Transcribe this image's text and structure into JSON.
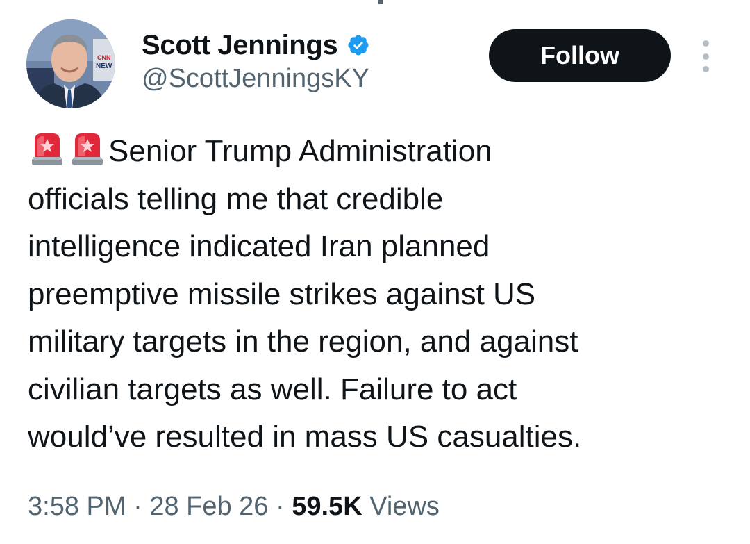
{
  "author": {
    "display_name": "Scott Jennings",
    "handle": "@ScottJenningsKY",
    "verified": true,
    "avatar_icon": "profile-photo"
  },
  "actions": {
    "follow_label": "Follow",
    "more_icon": "more-dots-icon"
  },
  "tweet": {
    "emoji": [
      "police-car-light",
      "police-car-light"
    ],
    "text_lines": [
      "Senior Trump Administration",
      "officials telling me that credible",
      "intelligence indicated Iran planned",
      "preemptive missile strikes against US",
      "military targets in the region, and against",
      "civilian targets as well. Failure to act",
      "would’ve resulted in mass US casualties."
    ]
  },
  "meta": {
    "time": "3:58 PM",
    "separator": "·",
    "date": "28 Feb 26",
    "views_count": "59.5K",
    "views_label": "Views"
  },
  "colors": {
    "text_primary": "#0f1419",
    "text_secondary": "#536471",
    "verified_blue": "#1d9bf0",
    "button_bg": "#0f1419"
  }
}
